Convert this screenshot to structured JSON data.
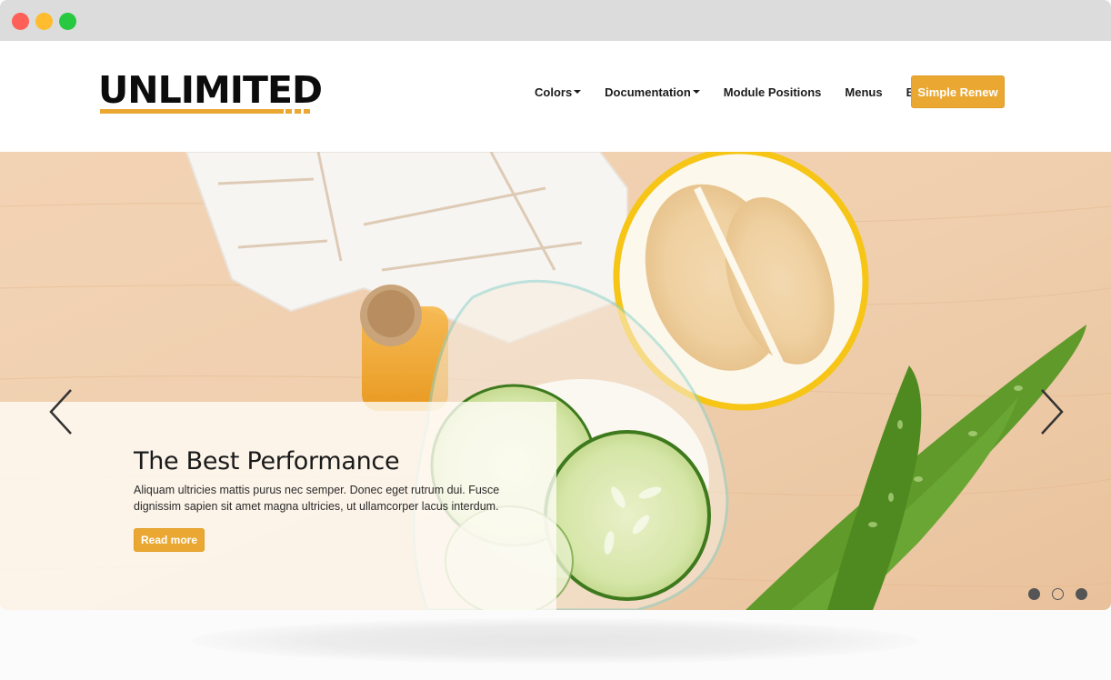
{
  "window": {
    "controls": [
      "close",
      "minimize",
      "maximize"
    ]
  },
  "header": {
    "logo_text": "UNLIMITED",
    "nav": [
      {
        "label": "Colors",
        "has_dropdown": true
      },
      {
        "label": "Documentation",
        "has_dropdown": true
      },
      {
        "label": "Module Positions",
        "has_dropdown": false
      },
      {
        "label": "Menus",
        "has_dropdown": false
      },
      {
        "label": "Blog",
        "has_dropdown": false
      }
    ],
    "cta_label": "Simple Renew"
  },
  "hero": {
    "slide": {
      "title": "The Best Performance",
      "text": "Aliquam ultricies mattis purus nec semper. Donec eget rutrum dui. Fusce dignissim sapien sit amet magna ultricies, ut ullamcorper lacus interdum.",
      "button_label": "Read more"
    },
    "image_description": "Spa ingredients on a wooden table: white towel, cork-stoppered oil bottle, glass bowl with cucumber slices in milk, halved lemon, aloe vera leaves",
    "prev_icon": "chevron-left-icon",
    "next_icon": "chevron-right-icon",
    "slide_count": 3,
    "active_slide": 2
  },
  "colors": {
    "accent": "#eaa833",
    "text_dark": "#1b1b1b",
    "chrome": "#dcdcdc",
    "traffic_red": "#fe5f57",
    "traffic_yellow": "#febc2e",
    "traffic_green": "#28c840"
  }
}
